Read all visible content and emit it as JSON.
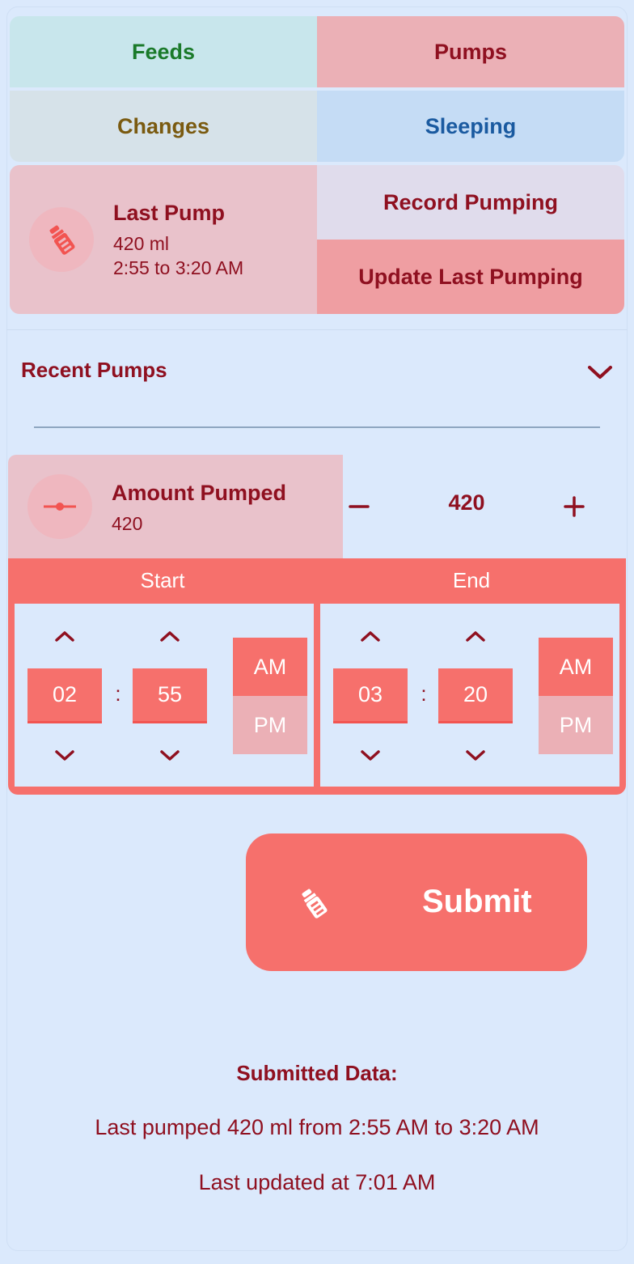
{
  "tabs": {
    "feeds": "Feeds",
    "pumps": "Pumps",
    "changes": "Changes",
    "sleeping": "Sleeping"
  },
  "summary": {
    "icon": "bottle-icon",
    "title": "Last Pump",
    "amount": "420 ml",
    "range": "2:55 to 3:20 AM",
    "record_label": "Record Pumping",
    "update_label": "Update Last Pumping"
  },
  "recent": {
    "label": "Recent Pumps",
    "icon": "chevron-down-icon"
  },
  "amount": {
    "icon": "slider-icon",
    "title": "Amount Pumped",
    "sub": "420",
    "value": "420",
    "decrement_icon": "minus-icon",
    "increment_icon": "plus-icon"
  },
  "picker": {
    "start": {
      "label": "Start",
      "hour": "02",
      "minute": "55",
      "colon": ":",
      "am": "AM",
      "pm": "PM",
      "selected": "AM"
    },
    "end": {
      "label": "End",
      "hour": "03",
      "minute": "20",
      "colon": ":",
      "am": "AM",
      "pm": "PM",
      "selected": "AM"
    }
  },
  "submit": {
    "label": "Submit",
    "icon": "bottle-icon"
  },
  "results": {
    "title": "Submitted Data:",
    "line1": "Last pumped 420 ml from 2:55 AM to 3:20 AM",
    "line2": "Last updated at 7:01 AM"
  },
  "colors": {
    "background": "#dbe9fc",
    "accent": "#f6706c",
    "text": "#8f1020",
    "pumps_tab": "#ebb0b6",
    "feeds_text": "#1a7a2a",
    "changes_text": "#7a5a10",
    "sleeping_text": "#1a5aa0"
  }
}
